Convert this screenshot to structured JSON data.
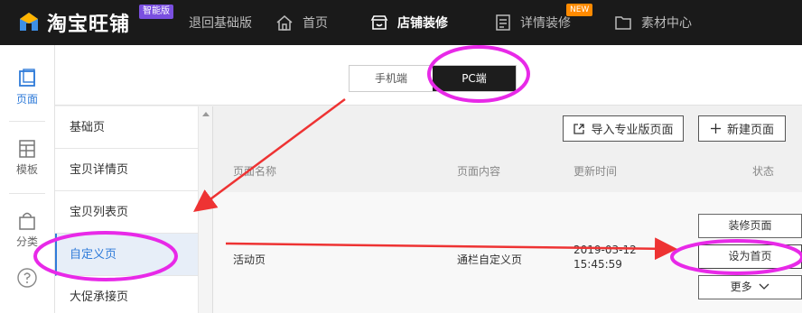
{
  "topbar": {
    "logo_text": "淘宝旺铺",
    "logo_badge": "智能版",
    "back_label": "退回基础版",
    "home_label": "首页",
    "store_label": "店铺装修",
    "detail_label": "详情装修",
    "detail_badge": "NEW",
    "media_label": "素材中心"
  },
  "sidebar": {
    "page_label": "页面",
    "template_label": "模板",
    "category_label": "分类"
  },
  "device_toggle": {
    "mobile_label": "手机端",
    "pc_label": "PC端",
    "selected": "PC端"
  },
  "page_types": {
    "items": [
      "基础页",
      "宝贝详情页",
      "宝贝列表页",
      "自定义页",
      "大促承接页"
    ],
    "selected": "自定义页"
  },
  "actions": {
    "import_label": "导入专业版页面",
    "new_label": "新建页面"
  },
  "table": {
    "headers": {
      "name": "页面名称",
      "content": "页面内容",
      "time": "更新时间",
      "status": "状态"
    },
    "rows": [
      {
        "name": "活动页",
        "content": "通栏自定义页",
        "time": "2019-03-12 15:45:59"
      }
    ]
  },
  "row_actions": {
    "decorate_label": "装修页面",
    "set_home_label": "设为首页",
    "more_label": "更多"
  },
  "colors": {
    "accent": "#2f7bd9",
    "topbar": "#1a1a1a",
    "annotation": "#e829e8",
    "arrow": "#ee3333"
  }
}
